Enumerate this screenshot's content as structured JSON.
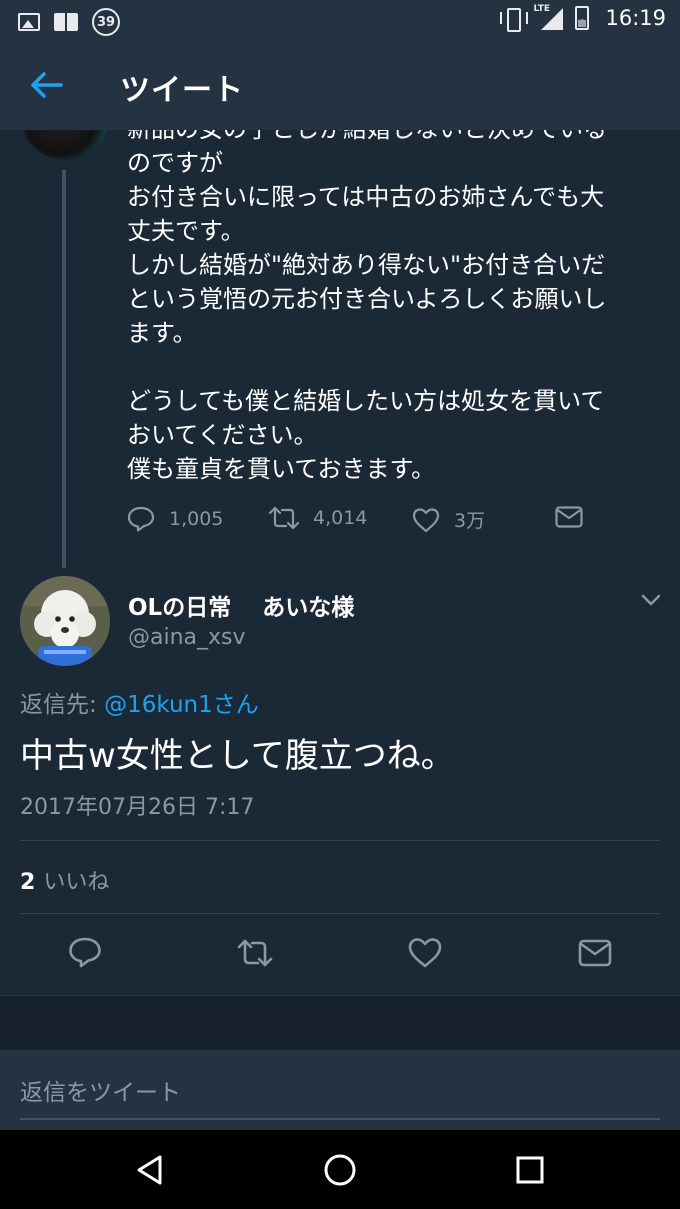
{
  "status_bar": {
    "badge": "39",
    "network": "LTE",
    "battery": "39",
    "battery_level": 0.39,
    "time": "16:19"
  },
  "app_bar": {
    "title": "ツイート"
  },
  "previous_tweet": {
    "text": "新品の女の子としか結婚しないと決めている\nのですが\nお付き合いに限っては中古のお姉さんでも大\n丈夫です。\nしかし結婚が\"絶対あり得ない\"お付き合いだ\nという覚悟の元お付き合いよろしくお願いし\nます。\n\nどうしても僕と結婚したい方は処女を貫いて\nおいてください。\n僕も童貞を貫いておきます。",
    "reply_count": "1,005",
    "retweet_count": "4,014",
    "like_count": "3万"
  },
  "tweet": {
    "display_name": "OLの日常　 あいな様",
    "handle": "@aina_xsv",
    "reply_label": "返信先: ",
    "reply_mention": "@16kun1さん",
    "text": "中古w女性として腹立つね。",
    "timestamp": "2017年07月26日 7:17",
    "likes_count": "2",
    "likes_label": "いいね"
  },
  "composer": {
    "placeholder": "返信をツイート"
  },
  "colors": {
    "background": "#1b2836",
    "bar": "#253241",
    "accent": "#1da1f2",
    "muted": "#8899a6"
  },
  "icons": [
    "back-arrow-icon",
    "reply-icon",
    "retweet-icon",
    "like-icon",
    "message-icon",
    "chevron-down-icon",
    "nav-back-icon",
    "nav-home-icon",
    "nav-recents-icon"
  ]
}
